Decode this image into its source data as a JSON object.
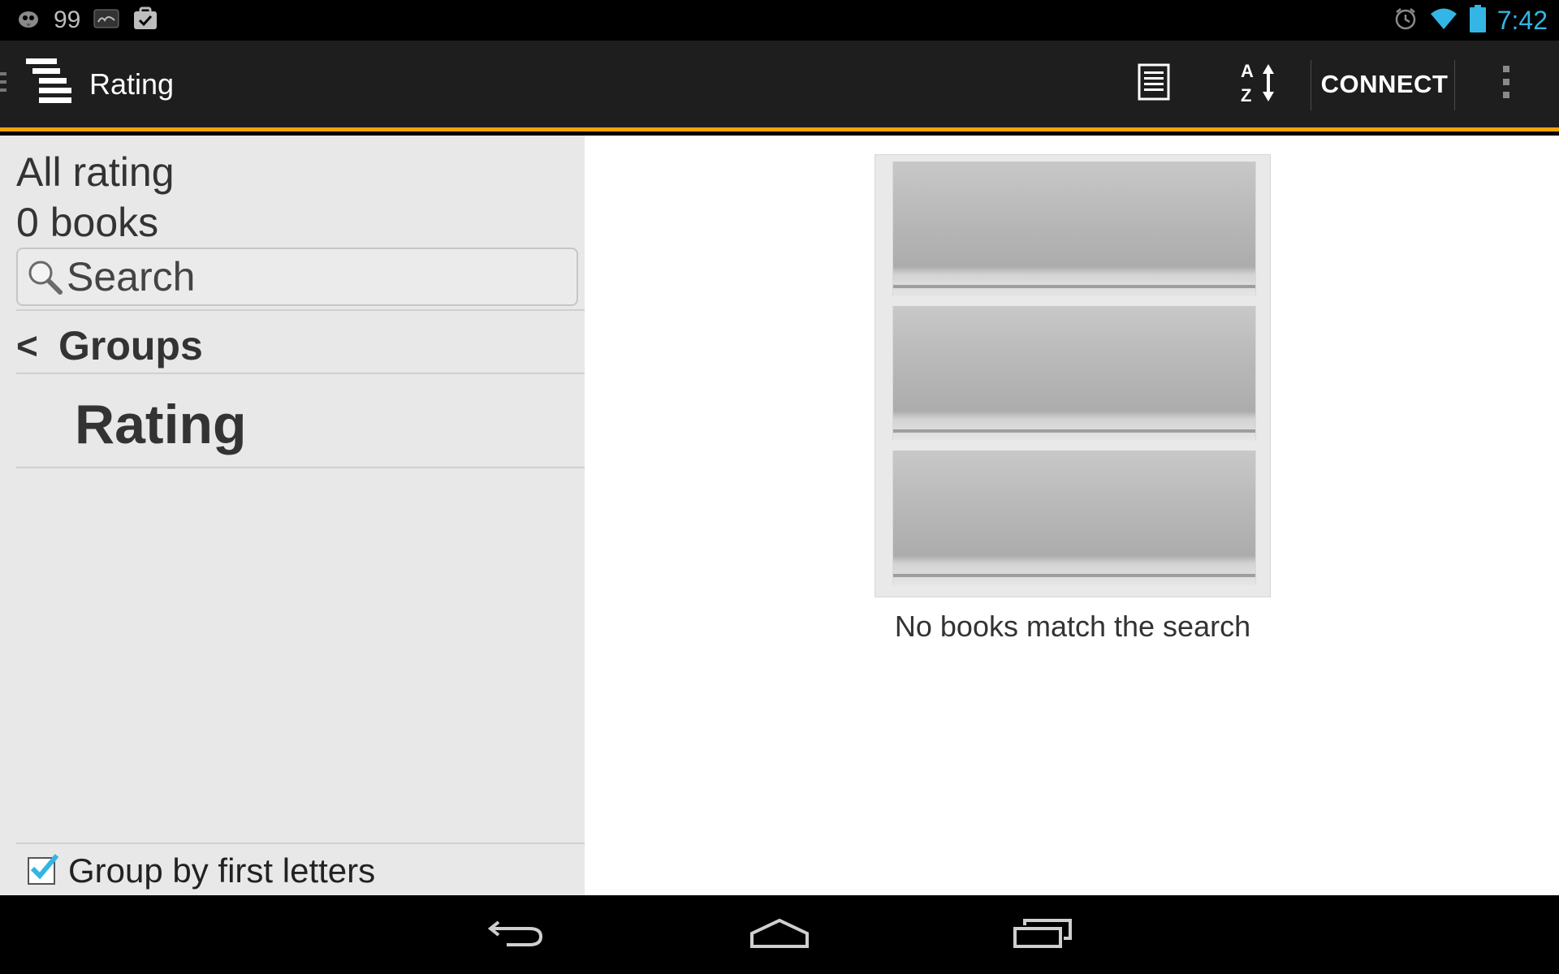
{
  "status_bar": {
    "notif_count": "99",
    "clock": "7:42",
    "icons": [
      "app-bird-icon",
      "weather-icon",
      "task-check-icon",
      "alarm-icon",
      "wifi-icon",
      "battery-icon"
    ],
    "clock_color": "#33b5e5"
  },
  "action_bar": {
    "title": "Rating",
    "connect_label": "CONNECT",
    "icons": [
      "menu-stack-icon",
      "list-view-icon",
      "sort-az-icon",
      "overflow-menu-icon"
    ],
    "accent_color": "#f0a30a"
  },
  "sidebar": {
    "title": "All rating",
    "count": "0 books",
    "search_placeholder": "Search",
    "groups_chevron": "<",
    "groups_label": "Groups",
    "selected_group": "Rating",
    "group_by_label": "Group by first letters",
    "group_by_checked": true
  },
  "main": {
    "empty_message": "No books match the search"
  },
  "nav_bar": {
    "icons": [
      "back-icon",
      "home-icon",
      "recents-icon"
    ]
  }
}
